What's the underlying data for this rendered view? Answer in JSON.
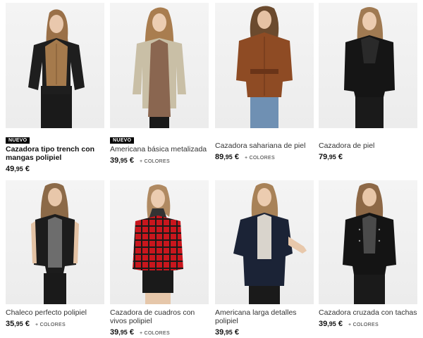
{
  "products": [
    {
      "badge": "NUEVO",
      "name": "Cazadora tipo trench con mangas polipiel",
      "price_int": "49",
      "price_dec": ",95",
      "currency": "€",
      "colors": "",
      "jacket": "camel-leather"
    },
    {
      "badge": "NUEVO",
      "name": "Americana básica metalizada",
      "price_int": "39",
      "price_dec": ",95",
      "currency": "€",
      "colors": "+ COLORES",
      "jacket": "beige-blazer"
    },
    {
      "badge": "",
      "name": "Cazadora sahariana de piel",
      "price_int": "89",
      "price_dec": ",95",
      "currency": "€",
      "colors": "+ COLORES",
      "jacket": "brown-leather"
    },
    {
      "badge": "",
      "name": "Cazadora de piel",
      "price_int": "79",
      "price_dec": ",95",
      "currency": "€",
      "colors": "",
      "jacket": "black-biker"
    },
    {
      "badge": "",
      "name": "Chaleco perfecto polipiel",
      "price_int": "35",
      "price_dec": ",95",
      "currency": "€",
      "colors": "+ COLORES",
      "jacket": "black-vest"
    },
    {
      "badge": "",
      "name": "Cazadora de cuadros con vivos polipiel",
      "price_int": "39",
      "price_dec": ",95",
      "currency": "€",
      "colors": "+ COLORES",
      "jacket": "red-plaid"
    },
    {
      "badge": "",
      "name": "Americana larga detalles polipiel",
      "price_int": "39",
      "price_dec": ",95",
      "currency": "€",
      "colors": "",
      "jacket": "navy-blazer"
    },
    {
      "badge": "",
      "name": "Cazadora cruzada con tachas",
      "price_int": "39",
      "price_dec": ",95",
      "currency": "€",
      "colors": "+ COLORES",
      "jacket": "black-studded"
    }
  ]
}
